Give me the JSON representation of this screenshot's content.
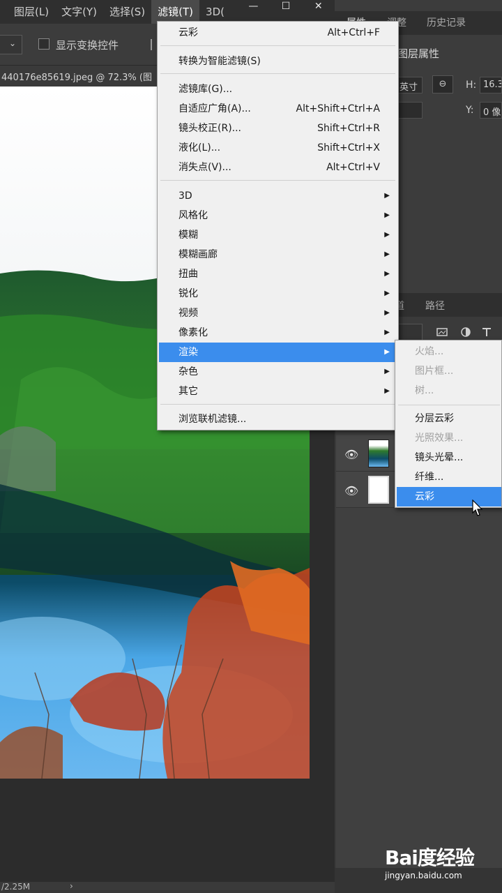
{
  "menubar": {
    "items": [
      "图层(L)",
      "文字(Y)",
      "选择(S)",
      "滤镜(T)",
      "3D("
    ],
    "window_controls": [
      "—",
      "☐",
      "✕"
    ]
  },
  "options_bar": {
    "show_transform_label": "显示变换控件"
  },
  "document": {
    "tab_label": "440176e85619.jpeg @ 72.3% (图",
    "status": "/2.25M",
    "status_arrow": "›"
  },
  "properties_panel": {
    "tabs": [
      "属性",
      "调整",
      "历史记录"
    ],
    "subtitle": "图层属性",
    "width_value": "英寸",
    "link_icon": "⊖",
    "h_label": "H:",
    "h_value": "16.3",
    "y_label": "Y:",
    "y_value": "0 像"
  },
  "layers_panel": {
    "tabs": [
      "道",
      "路径"
    ]
  },
  "filter_menu": {
    "items": [
      {
        "label": "云彩",
        "shortcut": "Alt+Ctrl+F"
      },
      {
        "label": "转换为智能滤镜(S)",
        "shortcut": ""
      },
      {
        "label": "滤镜库(G)...",
        "shortcut": ""
      },
      {
        "label": "自适应广角(A)...",
        "shortcut": "Alt+Shift+Ctrl+A"
      },
      {
        "label": "镜头校正(R)...",
        "shortcut": "Shift+Ctrl+R"
      },
      {
        "label": "液化(L)...",
        "shortcut": "Shift+Ctrl+X"
      },
      {
        "label": "消失点(V)...",
        "shortcut": "Alt+Ctrl+V"
      },
      {
        "label": "3D",
        "shortcut": ""
      },
      {
        "label": "风格化",
        "shortcut": ""
      },
      {
        "label": "模糊",
        "shortcut": ""
      },
      {
        "label": "模糊画廊",
        "shortcut": ""
      },
      {
        "label": "扭曲",
        "shortcut": ""
      },
      {
        "label": "锐化",
        "shortcut": ""
      },
      {
        "label": "视频",
        "shortcut": ""
      },
      {
        "label": "像素化",
        "shortcut": ""
      },
      {
        "label": "渲染",
        "shortcut": ""
      },
      {
        "label": "杂色",
        "shortcut": ""
      },
      {
        "label": "其它",
        "shortcut": ""
      },
      {
        "label": "浏览联机滤镜...",
        "shortcut": ""
      }
    ],
    "submenu_arrow": "▶",
    "highlighted": "渲染"
  },
  "render_submenu": {
    "items": [
      {
        "label": "火焰...",
        "enabled": "false"
      },
      {
        "label": "图片框...",
        "enabled": "false"
      },
      {
        "label": "树...",
        "enabled": "false"
      },
      {
        "label": "分层云彩",
        "enabled": "true"
      },
      {
        "label": "光照效果...",
        "enabled": "false"
      },
      {
        "label": "镜头光晕...",
        "enabled": "true"
      },
      {
        "label": "纤维...",
        "enabled": "true"
      },
      {
        "label": "云彩",
        "enabled": "true"
      }
    ],
    "highlighted": "云彩"
  },
  "watermark": {
    "logo": "Bai度经验",
    "url": "jingyan.baidu.com"
  },
  "colors": {
    "menu_highlight": "#3b8ded",
    "menu_bg": "#f0f0f0",
    "app_bg": "#3b3b3b"
  }
}
